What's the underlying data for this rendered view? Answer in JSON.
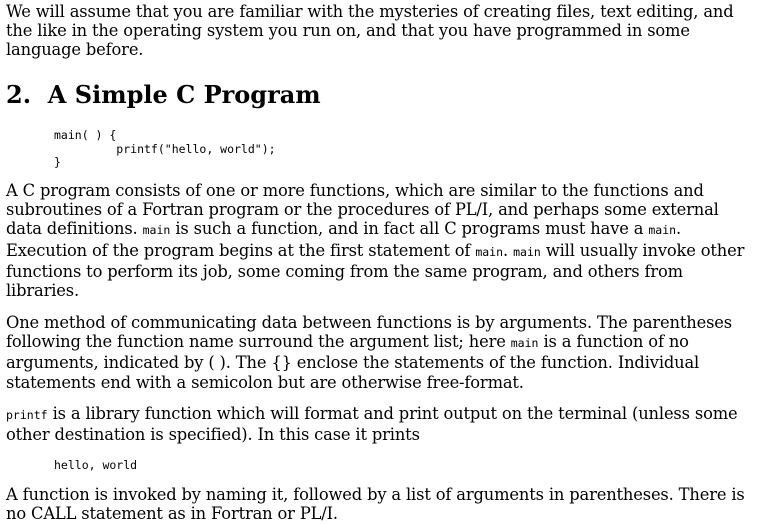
{
  "intro": "We will assume that you are familiar with the mysteries of creating files, text editing, and the like in the operating system you run on, and that you have programmed in some language before.",
  "section": {
    "number": "2.",
    "title": "A Simple C Program"
  },
  "code_example_1": "main( ) {\n         printf(\"hello, world\");\n}",
  "para1": {
    "t1": "A C program consists of one or more functions, which are similar to the functions and subroutines of a Fortran program or the procedures of PL/I, and perhaps some external data definitions. ",
    "c1": "main",
    "t2": " is such a function, and in fact all C programs must have a ",
    "c2": "main",
    "t3": ". Execution of the program begins at the first statement of ",
    "c3": "main",
    "t4": ". ",
    "c4": "main",
    "t5": " will usually invoke other functions to perform its job, some coming from the same program, and others from libraries."
  },
  "para2": {
    "t1": "One method of communicating data between functions is by arguments. The parentheses following the function name surround the argument list; here ",
    "c1": "main",
    "t2": " is a function of no arguments, indicated by ( ). The {} enclose the statements of the function. Individual statements end with a semicolon but are otherwise free-format."
  },
  "para3": {
    "c1": "printf",
    "t1": " is a library function which will format and print output on the terminal (unless some other destination is specified). In this case it prints"
  },
  "code_example_2": "hello, world",
  "para4": "A function is invoked by naming it, followed by a list of arguments in parentheses. There is no CALL statement as in Fortran or PL/I."
}
